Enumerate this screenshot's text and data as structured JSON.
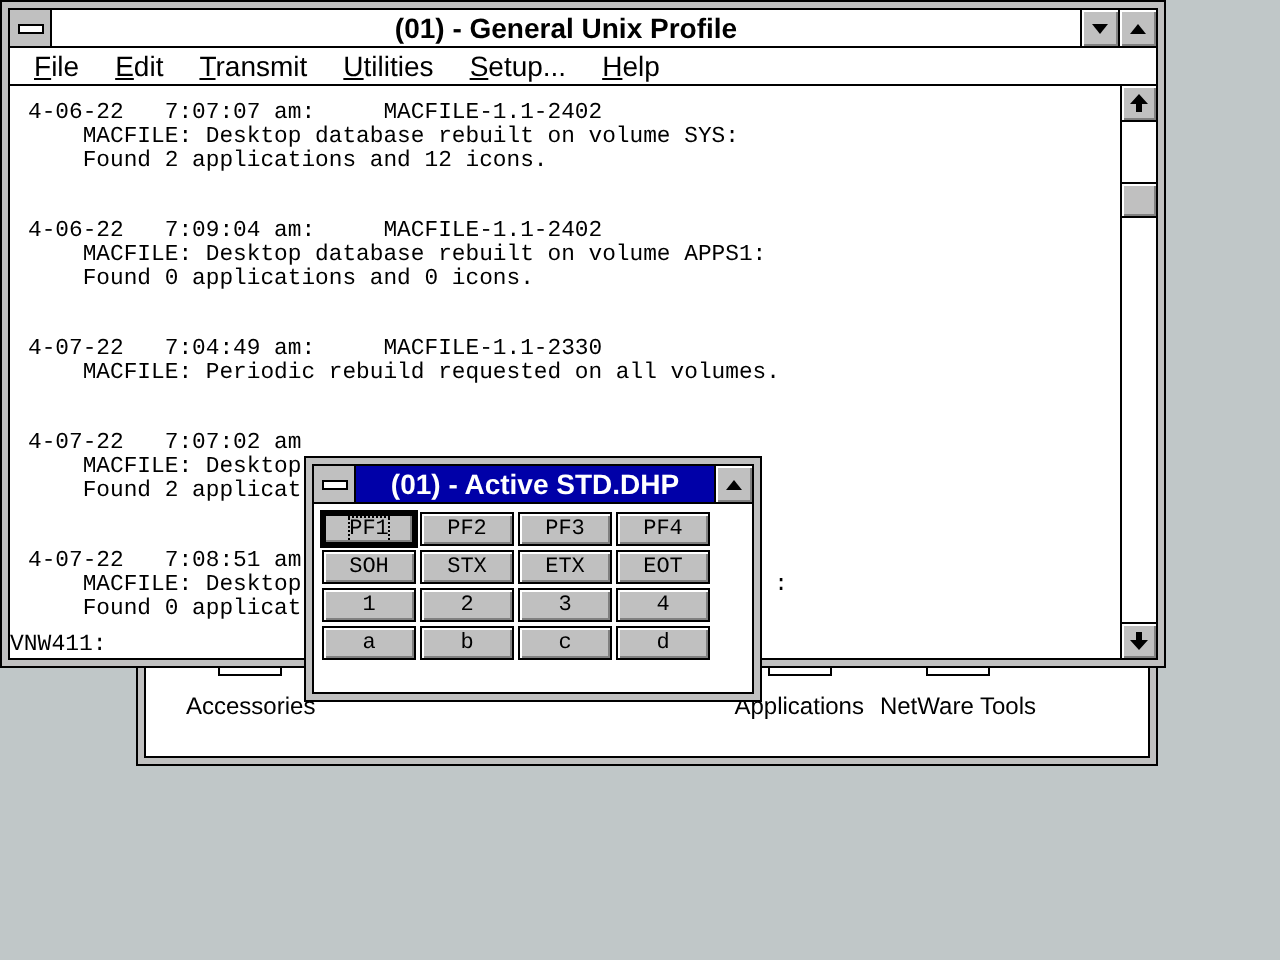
{
  "program_groups": [
    {
      "label": "Accessories"
    },
    {
      "label": "Applications"
    },
    {
      "label": "NetWare Tools"
    }
  ],
  "main_window": {
    "title": "(01) - General Unix Profile",
    "active": false,
    "menu": [
      "File",
      "Edit",
      "Transmit",
      "Utilities",
      "Setup...",
      "Help"
    ],
    "log": [
      {
        "lines": [
          "4-06-22   7:07:07 am:     MACFILE-1.1-2402",
          "    MACFILE: Desktop database rebuilt on volume SYS:",
          "    Found 2 applications and 12 icons."
        ]
      },
      {
        "lines": [
          "4-06-22   7:09:04 am:     MACFILE-1.1-2402",
          "    MACFILE: Desktop database rebuilt on volume APPS1:",
          "    Found 0 applications and 0 icons."
        ]
      },
      {
        "lines": [
          "4-07-22   7:04:49 am:     MACFILE-1.1-2330",
          "    MACFILE: Periodic rebuild requested on all volumes."
        ]
      },
      {
        "lines": [
          "4-07-22   7:07:02 am",
          "    MACFILE: Desktop",
          "    Found 2 applicat"
        ]
      },
      {
        "lines": [
          "4-07-22   7:08:51 am",
          "    MACFILE: Desktop",
          "    Found 0 applicat"
        ],
        "tail": ":"
      }
    ],
    "prompt": "VNW411:"
  },
  "keypad_window": {
    "title": "(01) - Active STD.DHP",
    "active": true,
    "keys": [
      {
        "label": "PF1",
        "focused": true
      },
      {
        "label": "PF2",
        "focused": false
      },
      {
        "label": "PF3",
        "focused": false
      },
      {
        "label": "PF4",
        "focused": false
      },
      {
        "label": "SOH",
        "focused": false
      },
      {
        "label": "STX",
        "focused": false
      },
      {
        "label": "ETX",
        "focused": false
      },
      {
        "label": "EOT",
        "focused": false
      },
      {
        "label": "1",
        "focused": false
      },
      {
        "label": "2",
        "focused": false
      },
      {
        "label": "3",
        "focused": false
      },
      {
        "label": "4",
        "focused": false
      },
      {
        "label": "a",
        "focused": false
      },
      {
        "label": "b",
        "focused": false
      },
      {
        "label": "c",
        "focused": false
      },
      {
        "label": "d",
        "focused": false
      }
    ]
  }
}
